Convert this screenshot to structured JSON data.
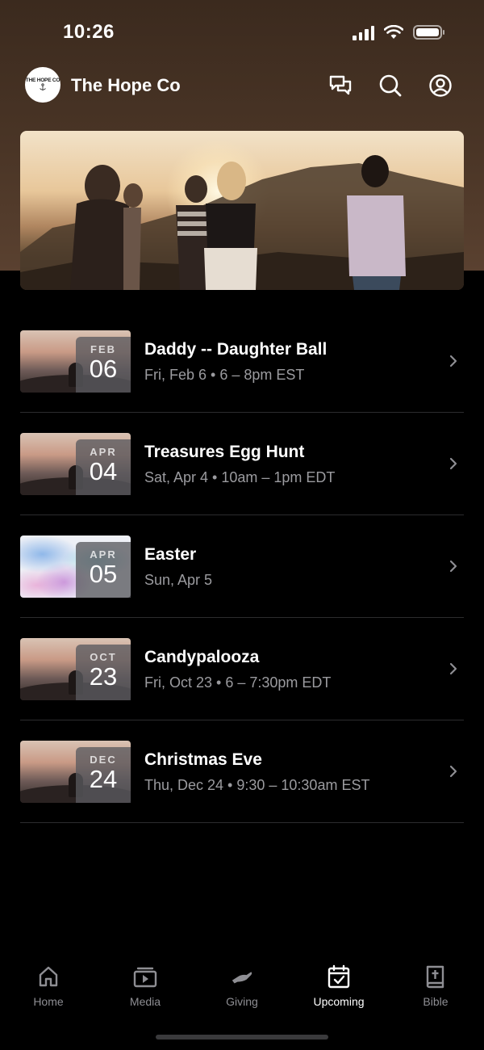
{
  "status_bar": {
    "time": "10:26"
  },
  "header": {
    "app_title": "The Hope Co",
    "logo_text": "THE HOPE CO",
    "actions": [
      {
        "name": "chat-icon"
      },
      {
        "name": "search-icon"
      },
      {
        "name": "account-icon"
      }
    ]
  },
  "events": [
    {
      "month": "FEB",
      "day": "06",
      "title": "Daddy -- Daughter Ball",
      "subtitle": "Fri, Feb 6 • 6 – 8pm EST",
      "thumb": "sunset"
    },
    {
      "month": "APR",
      "day": "04",
      "title": "Treasures Egg Hunt",
      "subtitle": "Sat, Apr 4 • 10am – 1pm EDT",
      "thumb": "sunset"
    },
    {
      "month": "APR",
      "day": "05",
      "title": "Easter",
      "subtitle": "Sun, Apr 5",
      "thumb": "paint"
    },
    {
      "month": "OCT",
      "day": "23",
      "title": "Candypalooza",
      "subtitle": "Fri, Oct 23 • 6 – 7:30pm EDT",
      "thumb": "sunset"
    },
    {
      "month": "DEC",
      "day": "24",
      "title": "Christmas Eve",
      "subtitle": "Thu, Dec 24 • 9:30 – 10:30am EST",
      "thumb": "sunset"
    }
  ],
  "tabs": [
    {
      "label": "Home",
      "icon": "home-icon",
      "active": false
    },
    {
      "label": "Media",
      "icon": "media-icon",
      "active": false
    },
    {
      "label": "Giving",
      "icon": "giving-icon",
      "active": false
    },
    {
      "label": "Upcoming",
      "icon": "calendar-icon",
      "active": true
    },
    {
      "label": "Bible",
      "icon": "bible-icon",
      "active": false
    }
  ],
  "colors": {
    "background": "#000000",
    "header_brown": "#4a3526",
    "text_primary": "#ffffff",
    "text_secondary": "#9b9b9f",
    "tab_inactive": "#8e8e93"
  }
}
